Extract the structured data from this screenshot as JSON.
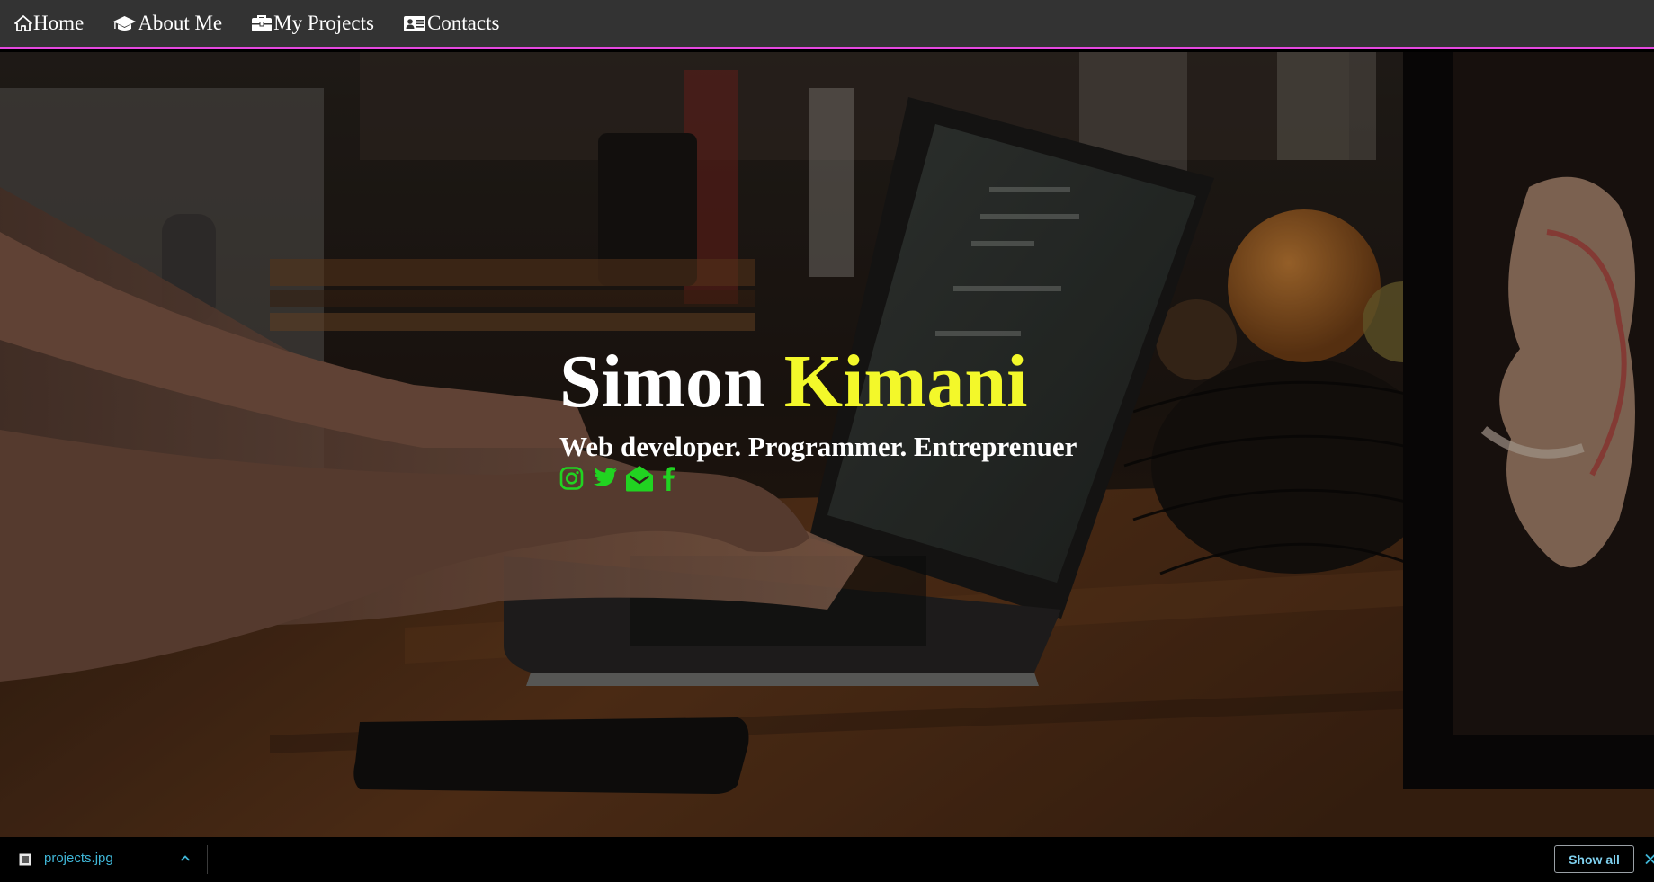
{
  "nav": {
    "items": [
      {
        "label": "Home",
        "icon": "home-icon"
      },
      {
        "label": "About Me",
        "icon": "graduation-cap-icon"
      },
      {
        "label": "My Projects",
        "icon": "briefcase-icon"
      },
      {
        "label": "Contacts",
        "icon": "address-card-icon"
      }
    ]
  },
  "hero": {
    "first_name": "Simon",
    "last_name": "Kimani",
    "tagline": "Web developer. Programmer. Entreprenuer",
    "socials": [
      "instagram-icon",
      "twitter-icon",
      "envelope-open-icon",
      "facebook-icon"
    ]
  },
  "downloads": {
    "file_name": "projects.jpg",
    "show_all_label": "Show all"
  },
  "colors": {
    "nav_bg": "#333333",
    "nav_border": "#e548e0",
    "accent_name": "#f3f82a",
    "social_icons": "#21d321",
    "download_link": "#3fb6d7"
  }
}
